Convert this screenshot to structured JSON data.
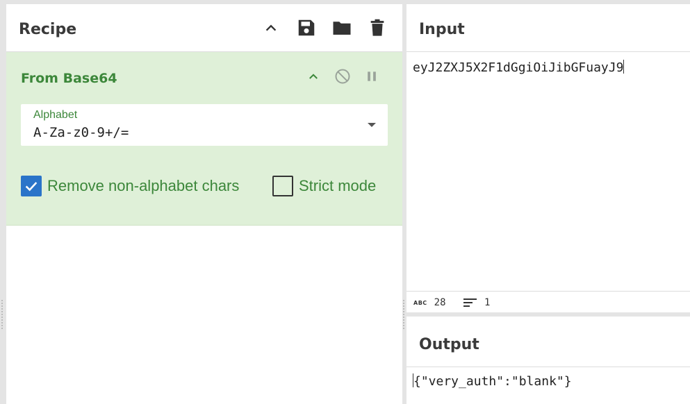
{
  "recipe": {
    "title": "Recipe",
    "operation": {
      "name": "From Base64",
      "alphabet": {
        "label": "Alphabet",
        "value": "A-Za-z0-9+/="
      },
      "remove_non_alphabet": {
        "label": "Remove non-alphabet chars",
        "checked": true
      },
      "strict_mode": {
        "label": "Strict mode",
        "checked": false
      }
    }
  },
  "input": {
    "title": "Input",
    "text": "eyJ2ZXJ5X2F1dGgiOiJibGFuayJ9",
    "status": {
      "length": "28",
      "lines": "1"
    }
  },
  "output": {
    "title": "Output",
    "text": "{\"very_auth\":\"blank\"}"
  },
  "colors": {
    "operation_bg": "#dff0d8",
    "operation_text": "#3c873a",
    "checkbox_accent": "#2a74c9"
  }
}
